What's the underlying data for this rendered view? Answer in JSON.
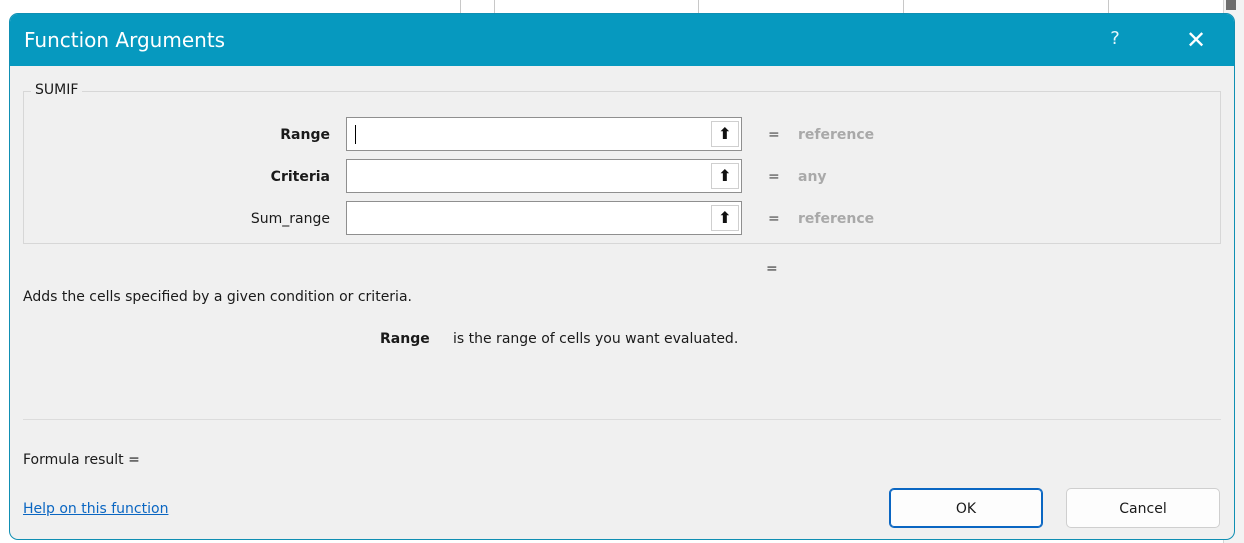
{
  "window": {
    "title": "Function Arguments",
    "help_glyph": "?",
    "close_glyph": "✕"
  },
  "function_group": {
    "name": "SUMIF",
    "arguments": [
      {
        "label": "Range",
        "bold": true,
        "value": "",
        "hint": "reference"
      },
      {
        "label": "Criteria",
        "bold": true,
        "value": "",
        "hint": "any"
      },
      {
        "label": "Sum_range",
        "bold": false,
        "value": "",
        "hint": "reference"
      }
    ],
    "collapse_icon": "upload-arrow-icon",
    "collapse_glyph": "⬆",
    "equals": "="
  },
  "result_equals": "=",
  "description": "Adds the cells specified by a given condition or criteria.",
  "argument_help": {
    "name": "Range",
    "text": "is the range of cells you want evaluated."
  },
  "footer": {
    "formula_result": "Formula result =",
    "help_link": "Help on this function",
    "ok_label": "OK",
    "cancel_label": "Cancel"
  },
  "colors": {
    "titlebar": "#0699bf",
    "dialog_bg": "#f0f0f0",
    "link": "#0a66c2",
    "hint_text": "#a9a9a9"
  }
}
